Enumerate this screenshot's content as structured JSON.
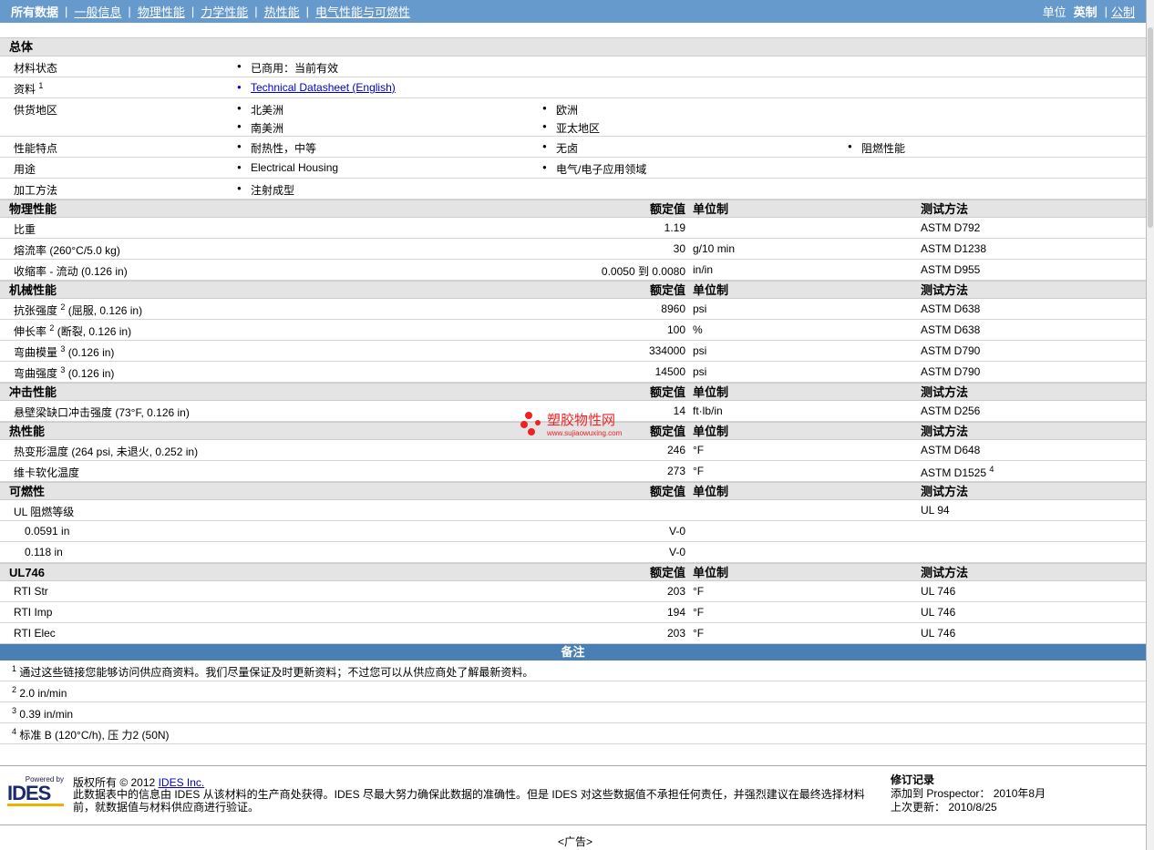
{
  "nav": {
    "items": [
      "所有数据",
      "一般信息",
      "物理性能",
      "力学性能",
      "热性能",
      "电气性能与可燃性"
    ],
    "unit_label": "单位",
    "unit_current": "英制",
    "unit_other": "公制"
  },
  "general": {
    "title": "总体",
    "rows": [
      {
        "label": "材料状态",
        "values": [
          "已商用：当前有效"
        ]
      },
      {
        "label": "资料",
        "sup": "1",
        "link": "Technical Datasheet (English)"
      },
      {
        "label": "供货地区",
        "values": [
          "北美洲",
          "欧洲",
          "南美洲",
          "亚太地区"
        ]
      },
      {
        "label": "性能特点",
        "values": [
          "耐热性，中等",
          "无卤",
          "阻燃性能"
        ]
      },
      {
        "label": "用途",
        "values": [
          "Electrical Housing",
          "电气/电子应用领域"
        ]
      },
      {
        "label": "加工方法",
        "values": [
          "注射成型"
        ]
      }
    ]
  },
  "col_headers": {
    "value": "额定值",
    "unit": "单位制",
    "method": "测试方法"
  },
  "sections": [
    {
      "title": "物理性能",
      "rows": [
        {
          "label": "比重",
          "value": "1.19",
          "unit": "",
          "method": "ASTM D792"
        },
        {
          "label": "熔流率  (260°C/5.0 kg)",
          "value": "30",
          "unit": "g/10 min",
          "method": "ASTM D1238"
        },
        {
          "label": "收缩率  - 流动  (0.126 in)",
          "value": "0.0050 到  0.0080",
          "unit": "in/in",
          "method": "ASTM D955"
        }
      ]
    },
    {
      "title": "机械性能",
      "rows": [
        {
          "label": "抗张强度",
          "sup": "2",
          "label2": "(屈服, 0.126 in)",
          "value": "8960",
          "unit": "psi",
          "method": "ASTM D638"
        },
        {
          "label": "伸长率",
          "sup": "2",
          "label2": "(断裂, 0.126 in)",
          "value": "100",
          "unit": "%",
          "method": "ASTM D638"
        },
        {
          "label": "弯曲模量",
          "sup": "3",
          "label2": "(0.126 in)",
          "value": "334000",
          "unit": "psi",
          "method": "ASTM D790"
        },
        {
          "label": "弯曲强度",
          "sup": "3",
          "label2": "(0.126 in)",
          "value": "14500",
          "unit": "psi",
          "method": "ASTM D790"
        }
      ]
    },
    {
      "title": "冲击性能",
      "rows": [
        {
          "label": "悬壁梁缺口冲击强度  (73°F, 0.126 in)",
          "value": "14",
          "unit": "ft·lb/in",
          "method": "ASTM D256"
        }
      ]
    },
    {
      "title": "热性能",
      "rows": [
        {
          "label": "热变形温度  (264 psi, 未退火, 0.252 in)",
          "value": "246",
          "unit": "°F",
          "method": "ASTM D648"
        },
        {
          "label": "维卡软化温度",
          "value": "273",
          "unit": "°F",
          "method": "ASTM D1525",
          "msup": "4"
        }
      ]
    },
    {
      "title": "可燃性",
      "rows": [
        {
          "label": "UL 阻燃等级",
          "value": "",
          "unit": "",
          "method": "UL 94"
        },
        {
          "label": "0.0591 in",
          "indent": true,
          "value": "V-0",
          "unit": "",
          "method": ""
        },
        {
          "label": "0.118 in",
          "indent": true,
          "value": "V-0",
          "unit": "",
          "method": ""
        }
      ]
    },
    {
      "title": "UL746",
      "rows": [
        {
          "label": "RTI Str",
          "value": "203",
          "unit": "°F",
          "method": "UL 746"
        },
        {
          "label": "RTI Imp",
          "value": "194",
          "unit": "°F",
          "method": "UL 746"
        },
        {
          "label": "RTI Elec",
          "value": "203",
          "unit": "°F",
          "method": "UL 746"
        }
      ]
    }
  ],
  "notes": {
    "title": "备注",
    "items": [
      {
        "sup": "1",
        "text": "通过这些链接您能够访问供应商资料。我们尽量保证及时更新资料；不过您可以从供应商处了解最新资料。"
      },
      {
        "sup": "2",
        "text": "2.0 in/min"
      },
      {
        "sup": "3",
        "text": "0.39 in/min"
      },
      {
        "sup": "4",
        "text": "标准  B (120°C/h), 压  力2 (50N)"
      }
    ]
  },
  "watermark": {
    "title": "塑胶物性网",
    "url": "www.sujiaowuxing.com"
  },
  "footer": {
    "logo_small": "Powered by",
    "logo": "IDES",
    "copyright": "版权所有  © 2012",
    "company": "IDES Inc.",
    "disclaimer": "此数据表中的信息由  IDES 从该材料的生产商处获得。IDES 尽最大努力确保此数据的准确性。但是  IDES 对这些数据值不承担任何责任，并强烈建议在最终选择材料前，就数据值与材料供应商进行验证。",
    "rev_title": "修订记录",
    "added": "添加到  Prospector：  2010年8月",
    "updated": "上次更新：  2010/8/25"
  },
  "ad": "<广告>"
}
